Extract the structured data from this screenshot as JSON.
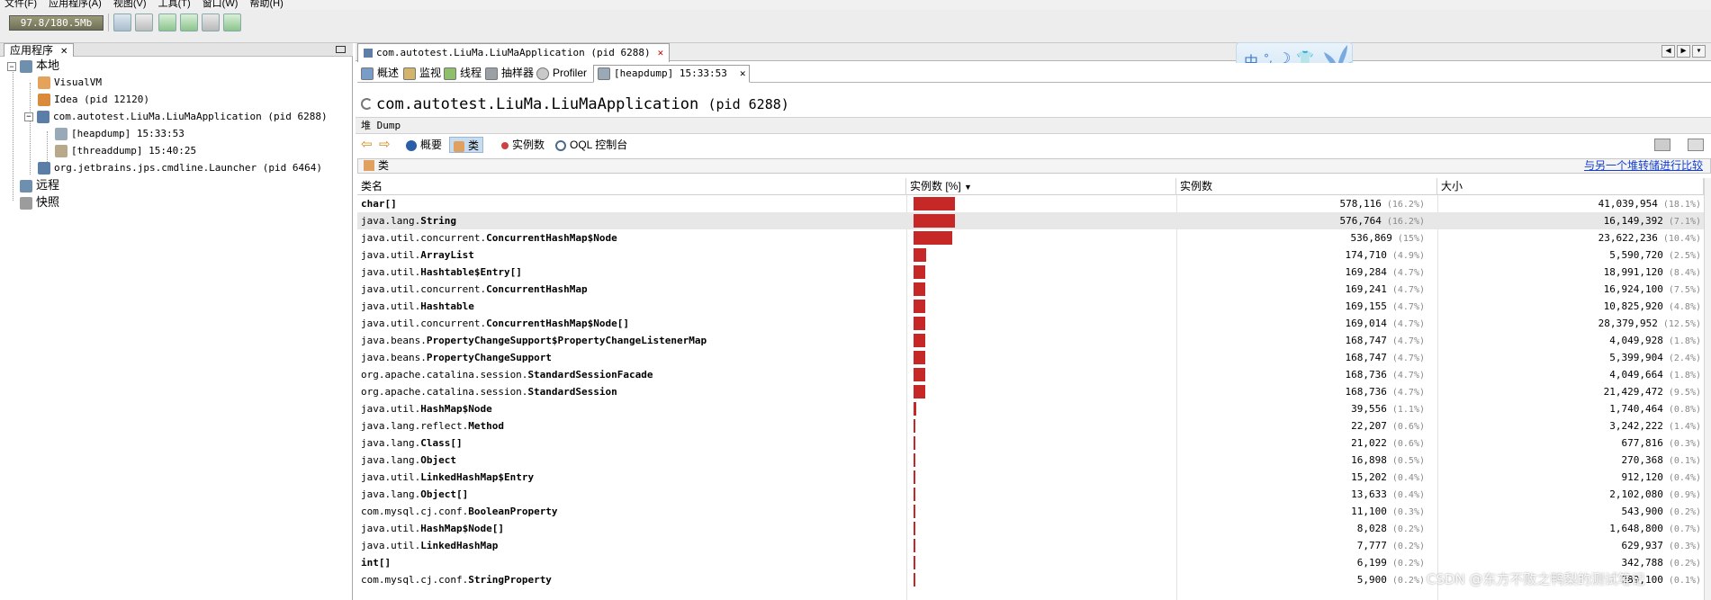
{
  "menubar": {
    "items": [
      "文件(F)",
      "应用程序(A)",
      "视图(V)",
      "工具(T)",
      "窗口(W)",
      "帮助(H)"
    ]
  },
  "toolbar": {
    "memory": "97.8/180.5Mb"
  },
  "left_panel": {
    "tab_label": "应用程序",
    "tree": {
      "local": "本地",
      "visualvm": "VisualVM",
      "idea": "Idea (pid 12120)",
      "app": "com.autotest.LiuMa.LiuMaApplication (pid 6288)",
      "heapdump": "[heapdump] 15:33:53",
      "threaddump": "[threaddump] 15:40:25",
      "launcher": "org.jetbrains.jps.cmdline.Launcher (pid 6464)",
      "remote": "远程",
      "snapshots": "快照"
    }
  },
  "doc_tab": {
    "label": "com.autotest.LiuMa.LiuMaApplication (pid 6288)"
  },
  "subtabs": {
    "overview": "概述",
    "monitor": "监视",
    "threads": "线程",
    "sampler": "抽样器",
    "profiler": "Profiler",
    "heapdump": "[heapdump] 15:33:53"
  },
  "app_title": {
    "name": "com.autotest.LiuMa.LiuMaApplication",
    "pid": "(pid 6288)"
  },
  "dump_label": "堆 Dump",
  "viewbar": {
    "summary": "概要",
    "classes": "类",
    "instances": "实例数",
    "oql": "OQL 控制台"
  },
  "classbar": {
    "label": "类",
    "compare_link": "与另一个堆转储进行比较"
  },
  "table": {
    "headers": {
      "name": "类名",
      "bar": "实例数 [%]",
      "count": "实例数",
      "size": "大小"
    },
    "max_count": 578116,
    "rows": [
      {
        "pkg": "",
        "cls": "char[]",
        "count": "578,116",
        "count_pct": "(16.2%)",
        "size": "41,039,954",
        "size_pct": "(18.1%)",
        "count_num": 578116
      },
      {
        "pkg": "java.lang.",
        "cls": "String",
        "count": "576,764",
        "count_pct": "(16.2%)",
        "size": "16,149,392",
        "size_pct": "(7.1%)",
        "count_num": 576764
      },
      {
        "pkg": "java.util.concurrent.",
        "cls": "ConcurrentHashMap$Node",
        "count": "536,869",
        "count_pct": "(15%)",
        "size": "23,622,236",
        "size_pct": "(10.4%)",
        "count_num": 536869
      },
      {
        "pkg": "java.util.",
        "cls": "ArrayList",
        "count": "174,710",
        "count_pct": "(4.9%)",
        "size": "5,590,720",
        "size_pct": "(2.5%)",
        "count_num": 174710
      },
      {
        "pkg": "java.util.",
        "cls": "Hashtable$Entry[]",
        "count": "169,284",
        "count_pct": "(4.7%)",
        "size": "18,991,120",
        "size_pct": "(8.4%)",
        "count_num": 169284
      },
      {
        "pkg": "java.util.concurrent.",
        "cls": "ConcurrentHashMap",
        "count": "169,241",
        "count_pct": "(4.7%)",
        "size": "16,924,100",
        "size_pct": "(7.5%)",
        "count_num": 169241
      },
      {
        "pkg": "java.util.",
        "cls": "Hashtable",
        "count": "169,155",
        "count_pct": "(4.7%)",
        "size": "10,825,920",
        "size_pct": "(4.8%)",
        "count_num": 169155
      },
      {
        "pkg": "java.util.concurrent.",
        "cls": "ConcurrentHashMap$Node[]",
        "count": "169,014",
        "count_pct": "(4.7%)",
        "size": "28,379,952",
        "size_pct": "(12.5%)",
        "count_num": 169014
      },
      {
        "pkg": "java.beans.",
        "cls": "PropertyChangeSupport$PropertyChangeListenerMap",
        "count": "168,747",
        "count_pct": "(4.7%)",
        "size": "4,049,928",
        "size_pct": "(1.8%)",
        "count_num": 168747
      },
      {
        "pkg": "java.beans.",
        "cls": "PropertyChangeSupport",
        "count": "168,747",
        "count_pct": "(4.7%)",
        "size": "5,399,904",
        "size_pct": "(2.4%)",
        "count_num": 168747
      },
      {
        "pkg": "org.apache.catalina.session.",
        "cls": "StandardSessionFacade",
        "count": "168,736",
        "count_pct": "(4.7%)",
        "size": "4,049,664",
        "size_pct": "(1.8%)",
        "count_num": 168736
      },
      {
        "pkg": "org.apache.catalina.session.",
        "cls": "StandardSession",
        "count": "168,736",
        "count_pct": "(4.7%)",
        "size": "21,429,472",
        "size_pct": "(9.5%)",
        "count_num": 168736
      },
      {
        "pkg": "java.util.",
        "cls": "HashMap$Node",
        "count": "39,556",
        "count_pct": "(1.1%)",
        "size": "1,740,464",
        "size_pct": "(0.8%)",
        "count_num": 39556
      },
      {
        "pkg": "java.lang.reflect.",
        "cls": "Method",
        "count": "22,207",
        "count_pct": "(0.6%)",
        "size": "3,242,222",
        "size_pct": "(1.4%)",
        "count_num": 22207
      },
      {
        "pkg": "java.lang.",
        "cls": "Class[]",
        "count": "21,022",
        "count_pct": "(0.6%)",
        "size": "677,816",
        "size_pct": "(0.3%)",
        "count_num": 21022
      },
      {
        "pkg": "java.lang.",
        "cls": "Object",
        "count": "16,898",
        "count_pct": "(0.5%)",
        "size": "270,368",
        "size_pct": "(0.1%)",
        "count_num": 16898
      },
      {
        "pkg": "java.util.",
        "cls": "LinkedHashMap$Entry",
        "count": "15,202",
        "count_pct": "(0.4%)",
        "size": "912,120",
        "size_pct": "(0.4%)",
        "count_num": 15202
      },
      {
        "pkg": "java.lang.",
        "cls": "Object[]",
        "count": "13,633",
        "count_pct": "(0.4%)",
        "size": "2,102,080",
        "size_pct": "(0.9%)",
        "count_num": 13633
      },
      {
        "pkg": "com.mysql.cj.conf.",
        "cls": "BooleanProperty",
        "count": "11,100",
        "count_pct": "(0.3%)",
        "size": "543,900",
        "size_pct": "(0.2%)",
        "count_num": 11100
      },
      {
        "pkg": "java.util.",
        "cls": "HashMap$Node[]",
        "count": "8,028",
        "count_pct": "(0.2%)",
        "size": "1,648,800",
        "size_pct": "(0.7%)",
        "count_num": 8028
      },
      {
        "pkg": "java.util.",
        "cls": "LinkedHashMap",
        "count": "7,777",
        "count_pct": "(0.2%)",
        "size": "629,937",
        "size_pct": "(0.3%)",
        "count_num": 7777
      },
      {
        "pkg": "",
        "cls": "int[]",
        "count": "6,199",
        "count_pct": "(0.2%)",
        "size": "342,788",
        "size_pct": "(0.2%)",
        "count_num": 6199
      },
      {
        "pkg": "com.mysql.cj.conf.",
        "cls": "StringProperty",
        "count": "5,900",
        "count_pct": "(0.2%)",
        "size": "289,100",
        "size_pct": "(0.1%)",
        "count_num": 5900
      }
    ]
  },
  "watermark": "CSDN @东方不败之鸭梨的测试笔记",
  "colors": {
    "bar": "#c62828",
    "selected_row": "#e7e7e7",
    "link": "#1640d0"
  }
}
